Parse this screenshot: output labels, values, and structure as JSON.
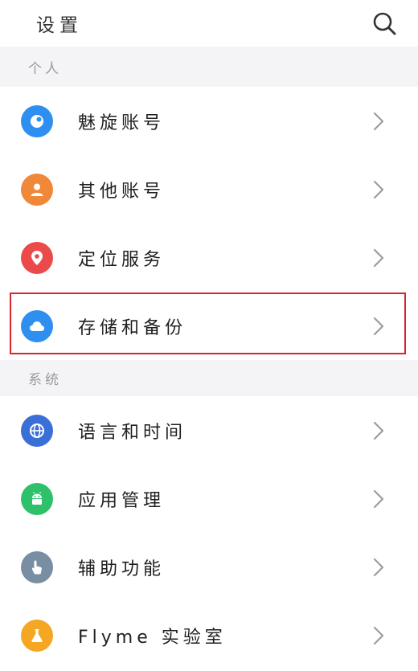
{
  "header": {
    "title": "设置",
    "search_icon": "search-icon"
  },
  "sections": [
    {
      "title": "个人",
      "items": [
        {
          "label": "魅旋账号",
          "icon": "meizu-account-icon",
          "color": "#2f8ff0"
        },
        {
          "label": "其他账号",
          "icon": "person-icon",
          "color": "#f0883a"
        },
        {
          "label": "定位服务",
          "icon": "location-pin-icon",
          "color": "#ea4a4a"
        },
        {
          "label": "存储和备份",
          "icon": "cloud-icon",
          "color": "#2f8ff0"
        }
      ]
    },
    {
      "title": "系统",
      "items": [
        {
          "label": "语言和时间",
          "icon": "globe-icon",
          "color": "#3a6fd8"
        },
        {
          "label": "应用管理",
          "icon": "android-icon",
          "color": "#2fc06a"
        },
        {
          "label": "辅助功能",
          "icon": "hand-pointer-icon",
          "color": "#7a8ea3"
        },
        {
          "label": "Flyme 实验室",
          "icon": "flask-icon",
          "color": "#f5a623"
        }
      ]
    }
  ],
  "colors": {
    "highlight_border": "#d8262c",
    "section_bg": "#f4f4f6"
  }
}
